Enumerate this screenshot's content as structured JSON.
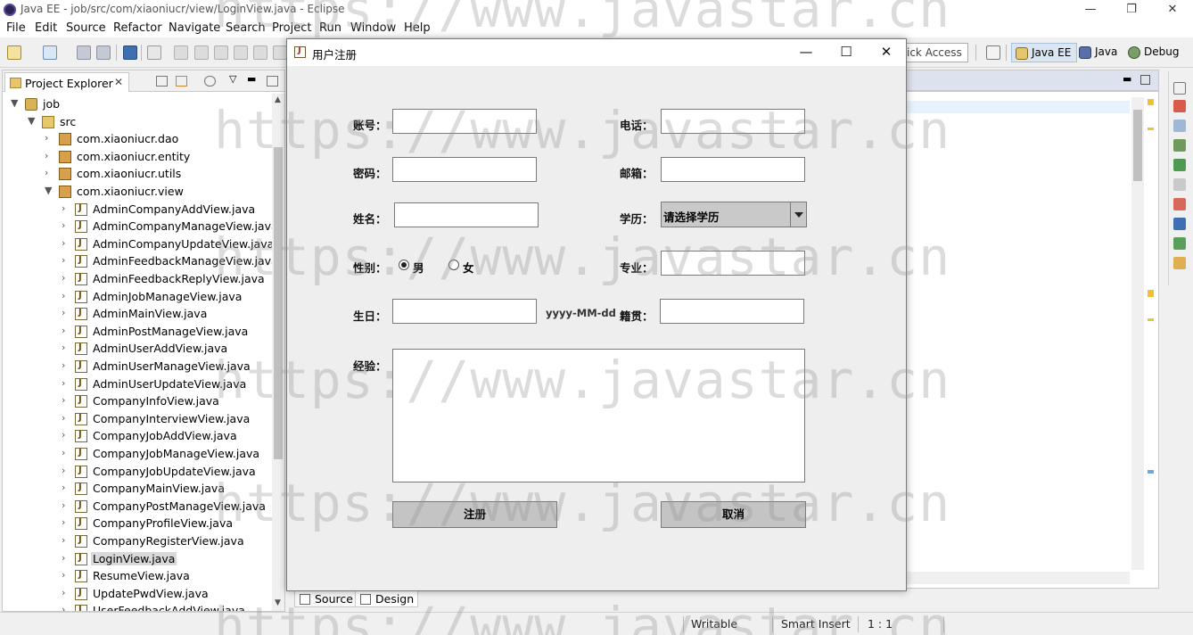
{
  "window": {
    "title": "Java EE - job/src/com/xiaoniucr/view/LoginView.java - Eclipse",
    "minimize": "—",
    "restore": "❐",
    "close": "✕"
  },
  "menu": [
    "File",
    "Edit",
    "Source",
    "Refactor",
    "Navigate",
    "Search",
    "Project",
    "Run",
    "Window",
    "Help"
  ],
  "toolbar": {
    "quick_access": "ick Access",
    "perspectives": [
      "Java EE",
      "Java",
      "Debug"
    ]
  },
  "explorer": {
    "tab_label": "Project Explorer",
    "tab_close": "✕",
    "project": "job",
    "src": "src",
    "packages": [
      "com.xiaoniucr.dao",
      "com.xiaoniucr.entity",
      "com.xiaoniucr.utils",
      "com.xiaoniucr.view"
    ],
    "files": [
      "AdminCompanyAddView.java",
      "AdminCompanyManageView.java",
      "AdminCompanyUpdateView.java",
      "AdminFeedbackManageView.java",
      "AdminFeedbackReplyView.java",
      "AdminJobManageView.java",
      "AdminMainView.java",
      "AdminPostManageView.java",
      "AdminUserAddView.java",
      "AdminUserManageView.java",
      "AdminUserUpdateView.java",
      "CompanyInfoView.java",
      "CompanyInterviewView.java",
      "CompanyJobAddView.java",
      "CompanyJobManageView.java",
      "CompanyJobUpdateView.java",
      "CompanyMainView.java",
      "CompanyPostManageView.java",
      "CompanyProfileView.java",
      "CompanyRegisterView.java",
      "LoginView.java",
      "ResumeView.java",
      "UpdatePwdView.java",
      "UserFeedbackAddView.java"
    ],
    "selected_file": "LoginView.java"
  },
  "editor_bottom_tabs": [
    "Source",
    "Design"
  ],
  "status": {
    "writable": "Writable",
    "insert_mode": "Smart Insert",
    "position": "1 : 1"
  },
  "dialog": {
    "title": "用户注册",
    "labels": {
      "account": "账号：",
      "phone": "电话：",
      "password": "密码：",
      "email": "邮箱：",
      "name": "姓名：",
      "education": "学历：",
      "gender": "性别：",
      "major": "专业：",
      "birthday": "生日：",
      "birthplace": "籍贯：",
      "experience": "经验："
    },
    "education_selected": "请选择学历",
    "gender_options": [
      "男",
      "女"
    ],
    "gender_selected": "男",
    "birthday_format": "yyyy-MM-dd",
    "register_button": "注册",
    "cancel_button": "取消"
  },
  "watermark": "https://www.javastar.cn"
}
